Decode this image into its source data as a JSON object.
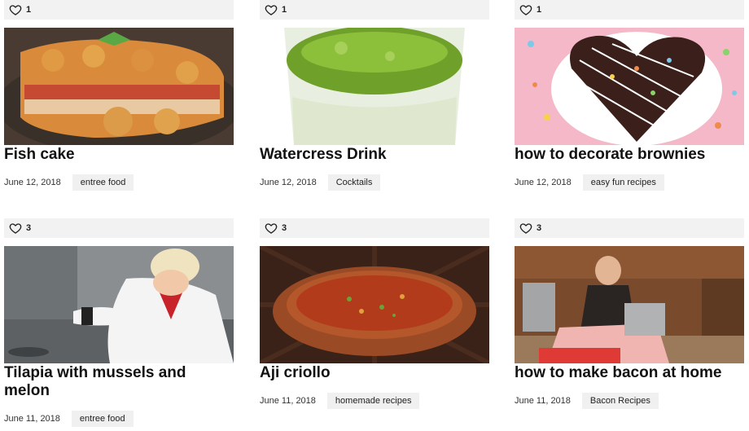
{
  "cards": [
    {
      "likes": "1",
      "title": "Fish cake",
      "date": "June 12, 2018",
      "tag": "entree food"
    },
    {
      "likes": "1",
      "title": "Watercress Drink",
      "date": "June 12, 2018",
      "tag": "Cocktails"
    },
    {
      "likes": "1",
      "title": "how to decorate brownies",
      "date": "June 12, 2018",
      "tag": "easy fun recipes"
    },
    {
      "likes": "3",
      "title": "Tilapia with mussels and melon",
      "date": "June 11, 2018",
      "tag": "entree food"
    },
    {
      "likes": "3",
      "title": "Aji criollo",
      "date": "June 11, 2018",
      "tag": "homemade recipes"
    },
    {
      "likes": "3",
      "title": "how to make bacon at home",
      "date": "June 11, 2018",
      "tag": "Bacon Recipes"
    }
  ]
}
